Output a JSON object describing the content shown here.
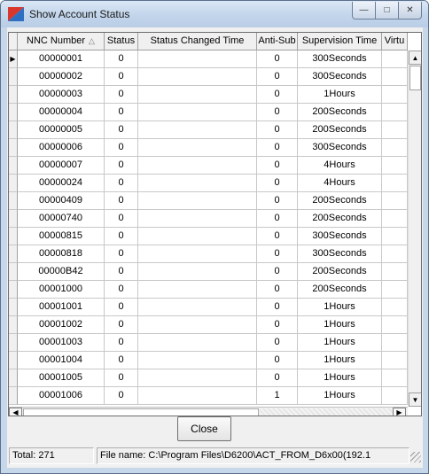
{
  "window": {
    "title": "Show Account Status",
    "buttons": {
      "minimize": "—",
      "maximize": "□",
      "close": "✕"
    }
  },
  "grid": {
    "columns": [
      "NNC Number",
      "Status",
      "Status Changed Time",
      "Anti-Sub",
      "Supervision Time",
      "Virtu"
    ],
    "sort_indicator": "△",
    "selected_row_marker": "▶",
    "rows": [
      [
        "00000001",
        "0",
        "",
        "0",
        "300Seconds",
        ""
      ],
      [
        "00000002",
        "0",
        "",
        "0",
        "300Seconds",
        ""
      ],
      [
        "00000003",
        "0",
        "",
        "0",
        "1Hours",
        ""
      ],
      [
        "00000004",
        "0",
        "",
        "0",
        "200Seconds",
        ""
      ],
      [
        "00000005",
        "0",
        "",
        "0",
        "200Seconds",
        ""
      ],
      [
        "00000006",
        "0",
        "",
        "0",
        "300Seconds",
        ""
      ],
      [
        "00000007",
        "0",
        "",
        "0",
        "4Hours",
        ""
      ],
      [
        "00000024",
        "0",
        "",
        "0",
        "4Hours",
        ""
      ],
      [
        "00000409",
        "0",
        "",
        "0",
        "200Seconds",
        ""
      ],
      [
        "00000740",
        "0",
        "",
        "0",
        "200Seconds",
        ""
      ],
      [
        "00000815",
        "0",
        "",
        "0",
        "300Seconds",
        ""
      ],
      [
        "00000818",
        "0",
        "",
        "0",
        "300Seconds",
        ""
      ],
      [
        "00000B42",
        "0",
        "",
        "0",
        "200Seconds",
        ""
      ],
      [
        "00001000",
        "0",
        "",
        "0",
        "200Seconds",
        ""
      ],
      [
        "00001001",
        "0",
        "",
        "0",
        "1Hours",
        ""
      ],
      [
        "00001002",
        "0",
        "",
        "0",
        "1Hours",
        ""
      ],
      [
        "00001003",
        "0",
        "",
        "0",
        "1Hours",
        ""
      ],
      [
        "00001004",
        "0",
        "",
        "0",
        "1Hours",
        ""
      ],
      [
        "00001005",
        "0",
        "",
        "0",
        "1Hours",
        ""
      ],
      [
        "00001006",
        "0",
        "",
        "1",
        "1Hours",
        ""
      ]
    ]
  },
  "scrollbars": {
    "up": "▲",
    "down": "▼",
    "left": "◀",
    "right": "▶"
  },
  "close_button": "Close",
  "statusbar": {
    "total": "Total: 271",
    "file": "File name: C:\\Program Files\\D6200\\ACT_FROM_D6x00(192.1"
  }
}
